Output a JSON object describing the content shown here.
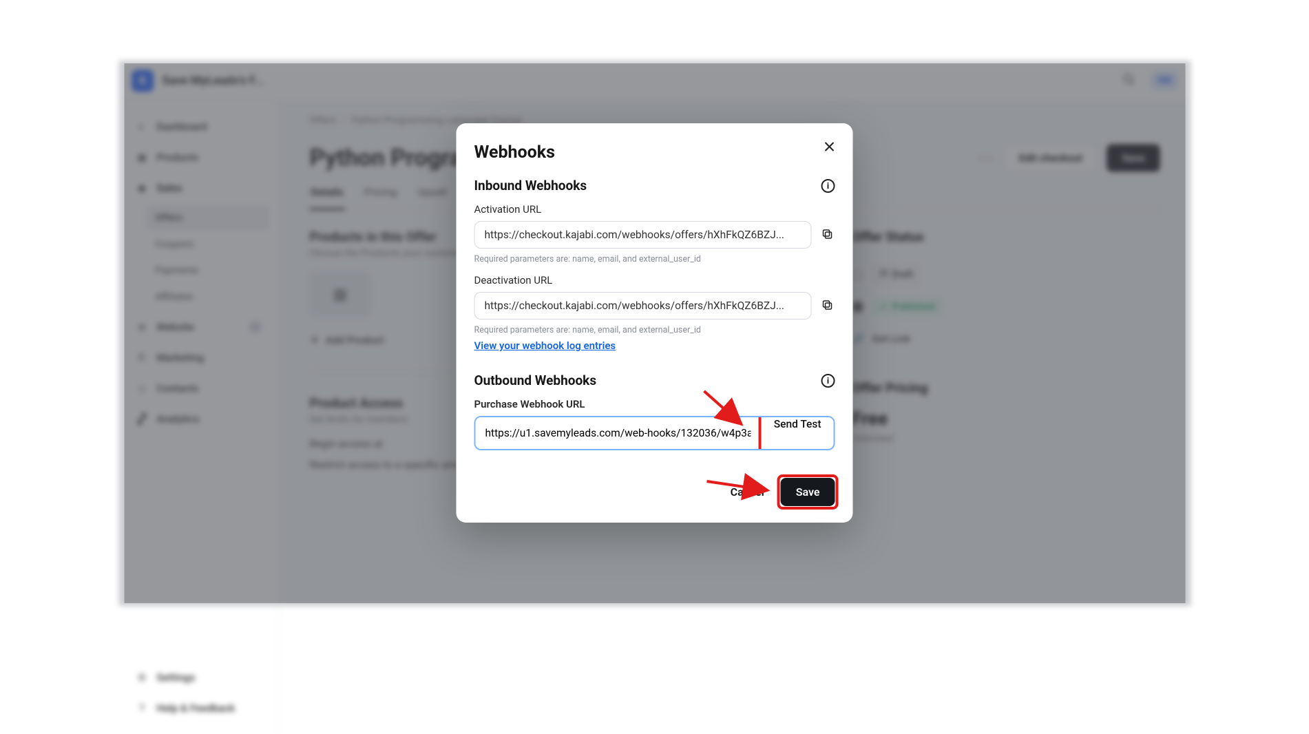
{
  "app": {
    "logo_letter": "K",
    "site_title": "Save MyLeads's F...",
    "badge": "SM"
  },
  "sidebar": {
    "items": [
      {
        "icon": "gauge",
        "label": "Dashboard"
      },
      {
        "icon": "box",
        "label": "Products"
      },
      {
        "icon": "tag",
        "label": "Sales"
      },
      {
        "icon": "globe",
        "label": "Website"
      },
      {
        "icon": "megaphone",
        "label": "Marketing"
      },
      {
        "icon": "user",
        "label": "Contacts"
      },
      {
        "icon": "chart",
        "label": "Analytics"
      }
    ],
    "sales_sub": [
      {
        "label": "Offers",
        "selected": true
      },
      {
        "label": "Coupons"
      },
      {
        "label": "Payments"
      },
      {
        "label": "Affiliates"
      }
    ],
    "bottom": [
      {
        "icon": "gear",
        "label": "Settings"
      },
      {
        "icon": "help",
        "label": "Help & Feedback"
      }
    ]
  },
  "breadcrumb": {
    "root": "Offers",
    "leaf": "Python Programming Language Course"
  },
  "page": {
    "title": "Python Programming Language Course",
    "edit_checkout": "Edit checkout",
    "save": "Save",
    "tabs": [
      "Details",
      "Pricing",
      "Upsell"
    ],
    "active_tab": 0
  },
  "products": {
    "heading": "Products in this Offer",
    "sub": "Choose the Products your customers will receive.",
    "add": "Add Product"
  },
  "access": {
    "heading": "Product Access",
    "sub": "Set limits for members",
    "line1": "Begin access at",
    "line2": "Restrict access to a specific amount of days"
  },
  "status": {
    "heading": "Offer Status",
    "draft": "Draft",
    "published": "Published",
    "getlink": "Get Link"
  },
  "pricing": {
    "heading": "Offer Pricing",
    "price": "Free",
    "sub": "Unlimited"
  },
  "modal": {
    "title": "Webhooks",
    "inbound_h": "Inbound Webhooks",
    "activation_label": "Activation URL",
    "activation_url": "https://checkout.kajabi.com/webhooks/offers/hXhFkQZ6BZJ...",
    "params_hint": "Required parameters are: name, email, and external_user_id",
    "deactivation_label": "Deactivation URL",
    "deactivation_url": "https://checkout.kajabi.com/webhooks/offers/hXhFkQZ6BZJ...",
    "log_link": "View your webhook log entries",
    "outbound_h": "Outbound Webhooks",
    "purchase_label": "Purchase Webhook URL",
    "purchase_url": "https://u1.savemyleads.com/web-hooks/132036/w4p3a",
    "send_test": "Send Test",
    "cancel": "Cancel",
    "save": "Save"
  }
}
